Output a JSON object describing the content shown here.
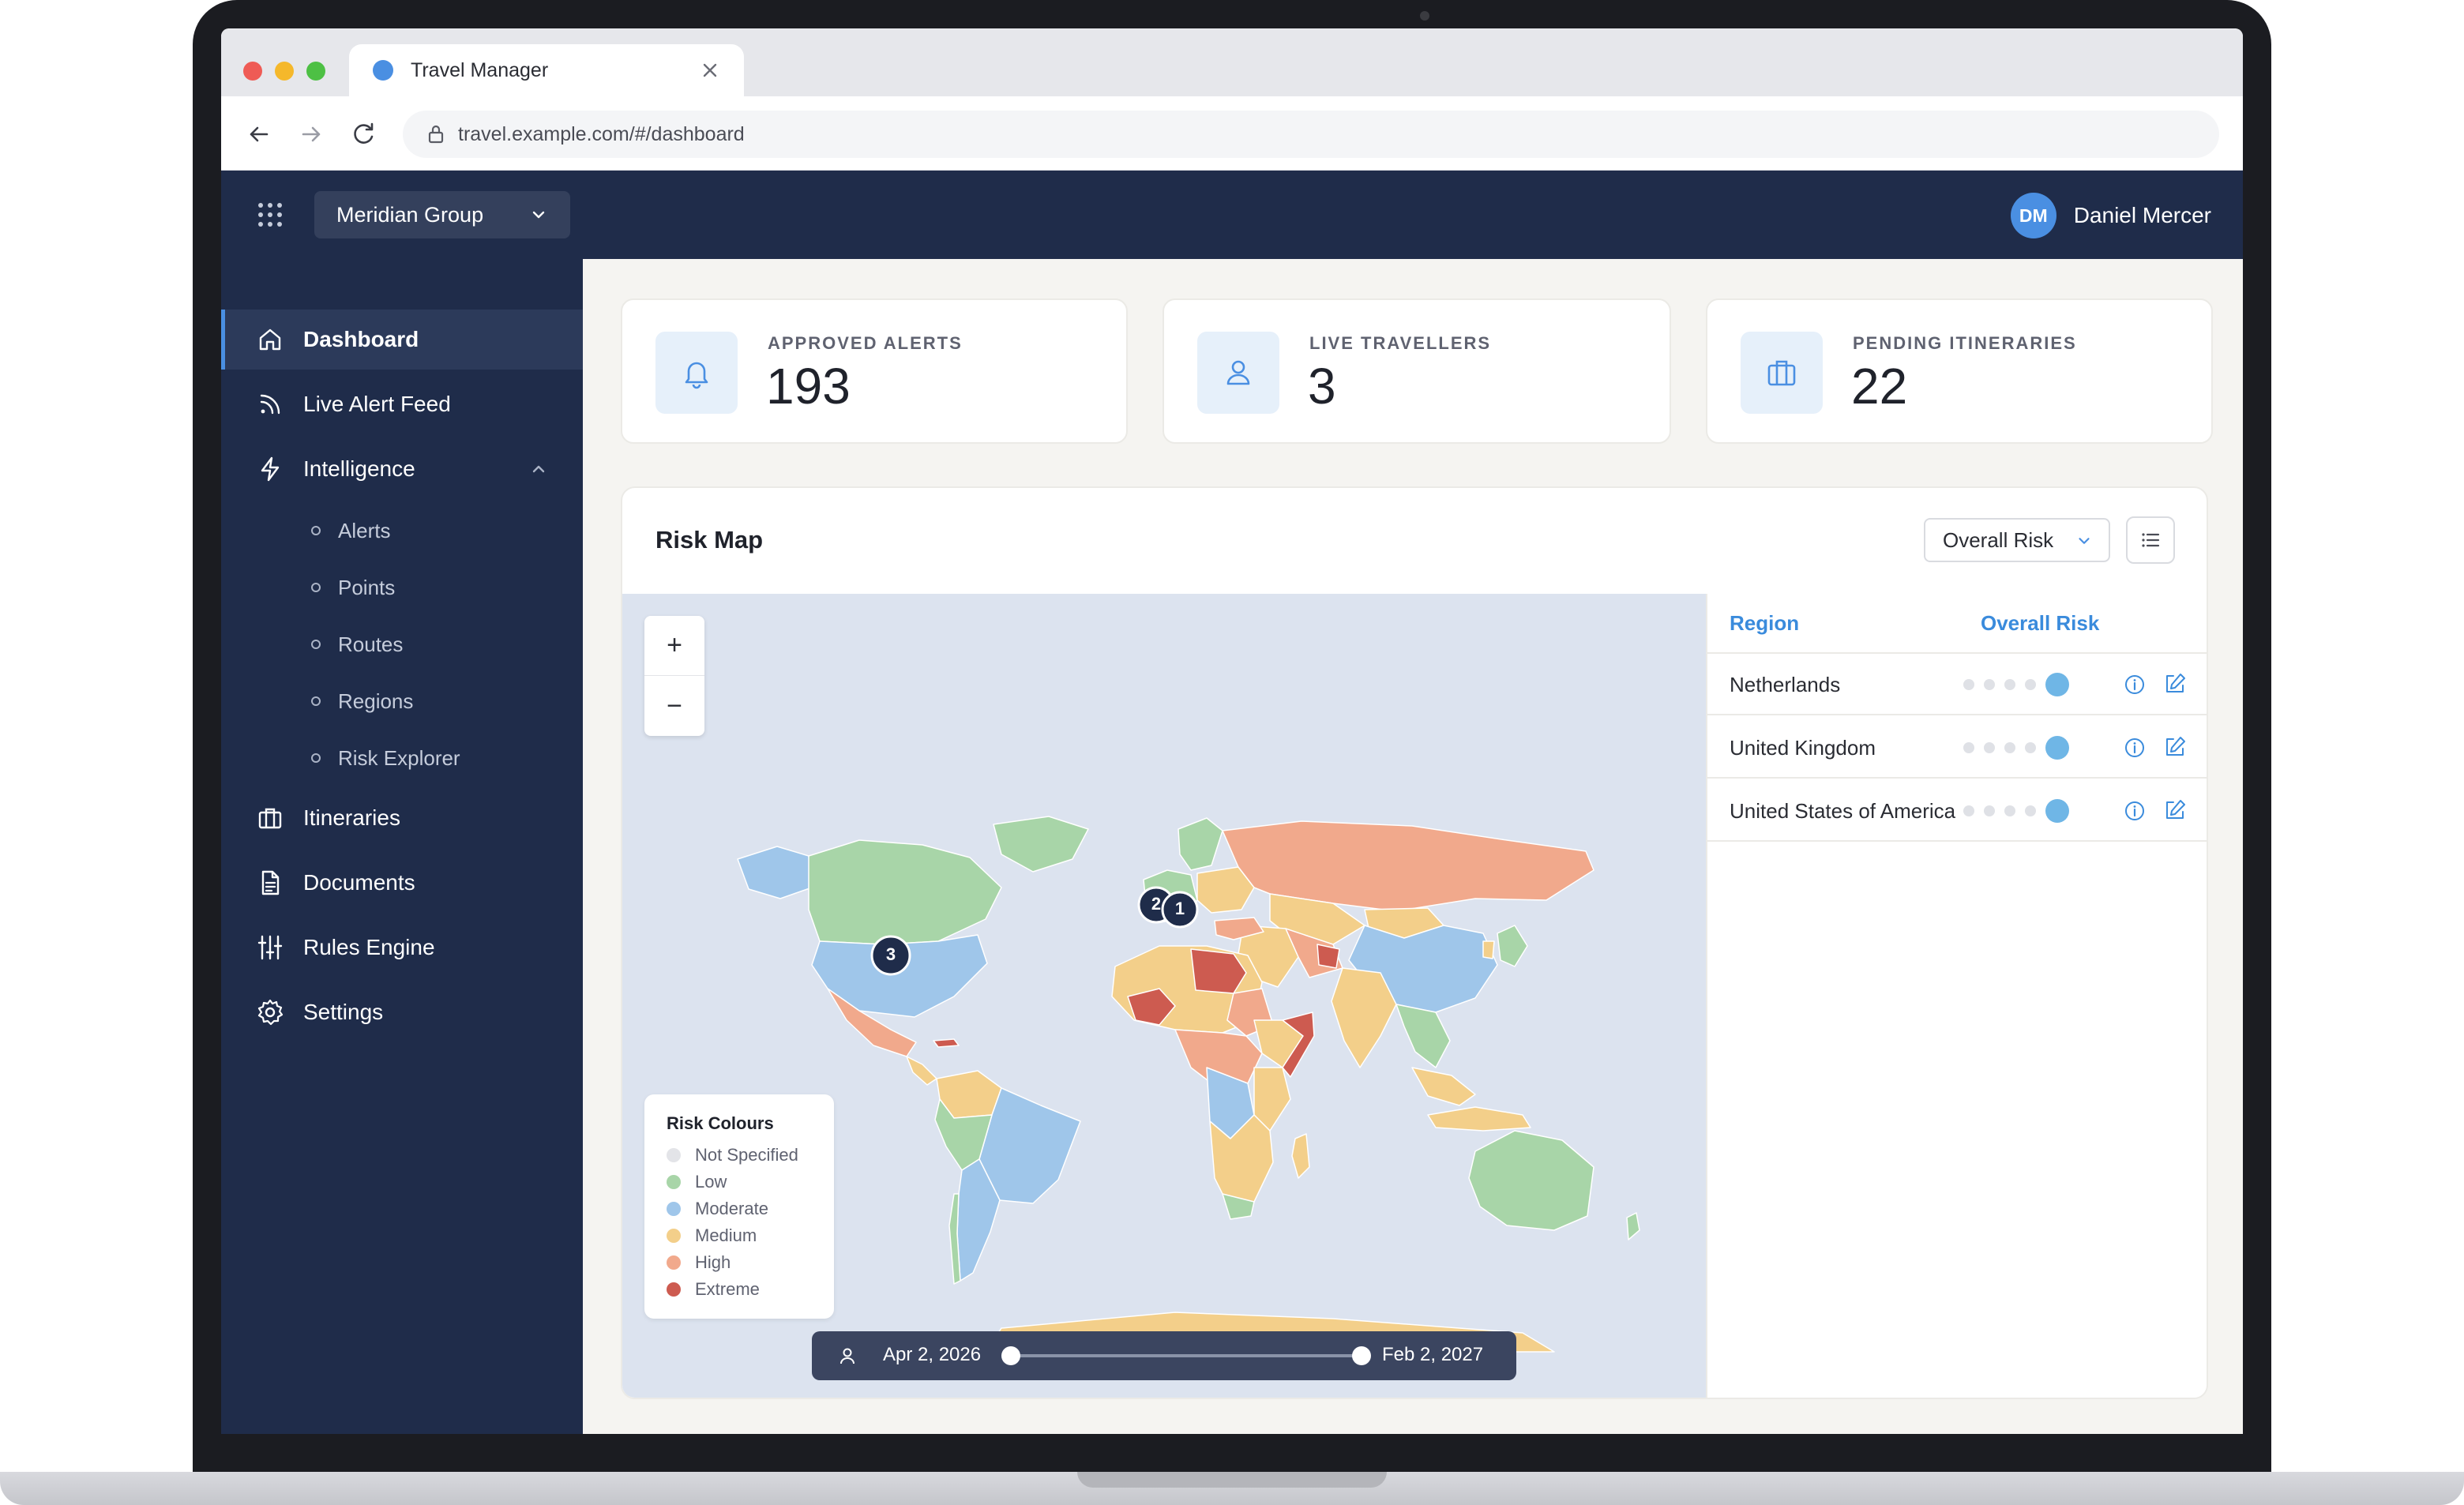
{
  "browser": {
    "tab_title": "Travel Manager",
    "url": "travel.example.com/#/dashboard"
  },
  "header": {
    "org": "Meridian Group",
    "user_initials": "DM",
    "user_name": "Daniel Mercer"
  },
  "sidebar": {
    "items": [
      {
        "label": "Dashboard",
        "icon": "home-icon"
      },
      {
        "label": "Live Alert Feed",
        "icon": "rss-icon"
      },
      {
        "label": "Intelligence",
        "icon": "lightning-icon"
      },
      {
        "label": "Itineraries",
        "icon": "briefcase-icon"
      },
      {
        "label": "Documents",
        "icon": "document-icon"
      },
      {
        "label": "Rules Engine",
        "icon": "sliders-icon"
      },
      {
        "label": "Settings",
        "icon": "gear-icon"
      }
    ],
    "sub_items": [
      "Alerts",
      "Points",
      "Routes",
      "Regions",
      "Risk Explorer"
    ]
  },
  "stats": [
    {
      "label": "APPROVED ALERTS",
      "value": "193",
      "icon": "bell-icon"
    },
    {
      "label": "LIVE TRAVELLERS",
      "value": "3",
      "icon": "person-icon"
    },
    {
      "label": "PENDING ITINERARIES",
      "value": "22",
      "icon": "briefcase-icon"
    }
  ],
  "map": {
    "title": "Risk Map",
    "risk_filter": "Overall Risk",
    "zoom_in": "+",
    "zoom_out": "−",
    "clusters": [
      "2",
      "1",
      "3"
    ],
    "legend": {
      "title": "Risk Colours",
      "items": [
        {
          "label": "Not Specified",
          "color": "#e3e4e8"
        },
        {
          "label": "Low",
          "color": "#a8d5a8"
        },
        {
          "label": "Moderate",
          "color": "#9fc6ea"
        },
        {
          "label": "Medium",
          "color": "#f3cf8a"
        },
        {
          "label": "High",
          "color": "#f1a98c"
        },
        {
          "label": "Extreme",
          "color": "#cd5b50"
        }
      ]
    },
    "timeline": {
      "start": "Apr 2, 2026",
      "end": "Feb 2, 2027"
    }
  },
  "regions": {
    "col_region": "Region",
    "col_risk": "Overall Risk",
    "rows": [
      {
        "name": "Netherlands"
      },
      {
        "name": "United Kingdom"
      },
      {
        "name": "United States of America"
      }
    ]
  }
}
